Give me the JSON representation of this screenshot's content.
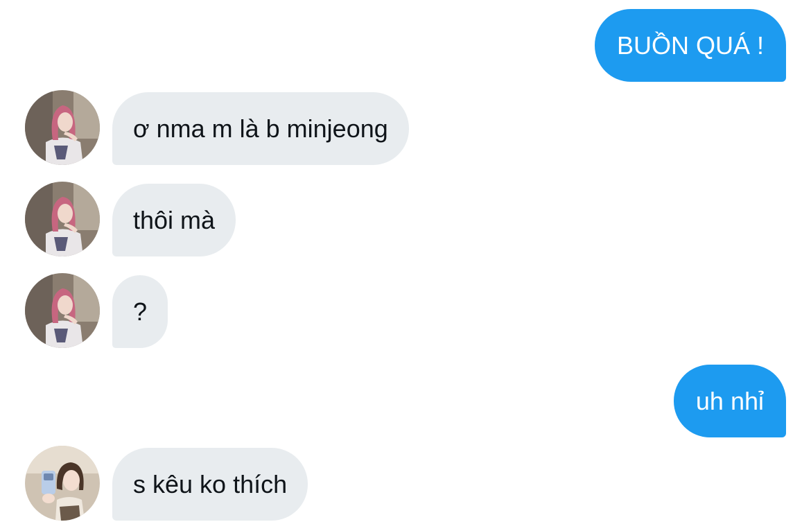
{
  "colors": {
    "outgoing_bubble": "#1d9bf0",
    "incoming_bubble": "#e8ecef",
    "incoming_text": "#0f1419",
    "outgoing_text": "#ffffff"
  },
  "messages": [
    {
      "direction": "outgoing",
      "text": "BUỒN QUÁ !"
    },
    {
      "direction": "incoming",
      "text": "ơ nma m là b minjeong",
      "avatar": "avatar-pink-hair"
    },
    {
      "direction": "incoming",
      "text": "thôi mà",
      "avatar": "avatar-pink-hair"
    },
    {
      "direction": "incoming",
      "text": "?",
      "avatar": "avatar-pink-hair"
    },
    {
      "direction": "outgoing",
      "text": "uh nhỉ"
    },
    {
      "direction": "incoming",
      "text": "s kêu ko thích",
      "avatar": "avatar-mirror-selfie"
    }
  ]
}
